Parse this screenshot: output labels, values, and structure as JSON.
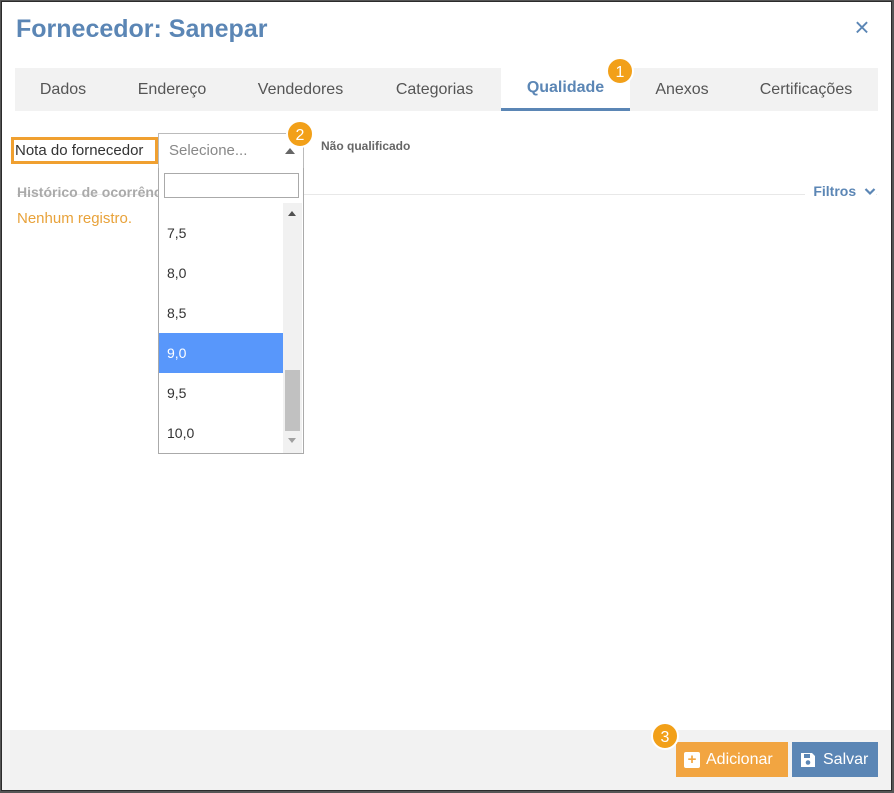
{
  "modal": {
    "title": "Fornecedor: Sanepar",
    "close_glyph": "×"
  },
  "tabs": [
    {
      "label": "Dados"
    },
    {
      "label": "Endereço"
    },
    {
      "label": "Vendedores"
    },
    {
      "label": "Categorias"
    },
    {
      "label": "Qualidade",
      "active": true
    },
    {
      "label": "Anexos"
    },
    {
      "label": "Certificações"
    }
  ],
  "badges": {
    "b1": "1",
    "b2": "2",
    "b3": "3",
    "color": "#f2a019"
  },
  "quality": {
    "nota_label": "Nota do fornecedor",
    "select_placeholder": "Selecione...",
    "status": "Não qualificado"
  },
  "dropdown": {
    "search_value": "",
    "options": [
      "7,5",
      "8,0",
      "8,5",
      "9,0",
      "9,5",
      "10,0"
    ],
    "selected": "9,0"
  },
  "history": {
    "title": "Histórico de ocorrências",
    "filters_label": "Filtros",
    "empty_message": "Nenhum registro."
  },
  "footer": {
    "add_label": "Adicionar",
    "save_label": "Salvar"
  },
  "colors": {
    "accent": "#5b86b5",
    "orange": "#f2a541",
    "selection": "#5897fb"
  }
}
